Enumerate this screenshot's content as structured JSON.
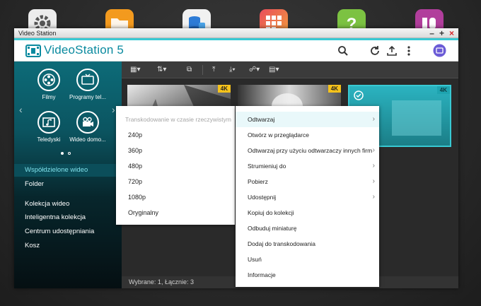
{
  "desktop": {
    "icons": [
      "settings-icon",
      "file-station-icon",
      "storage-icon",
      "app-center-icon",
      "help-icon",
      "hd-station-icon"
    ]
  },
  "window": {
    "title": "Video Station",
    "controls": {
      "minimize": "–",
      "maximize": "+",
      "close": "×"
    }
  },
  "app": {
    "title": "VideoStation 5",
    "accent_color": "#38c9d3",
    "brand_color": "#0a8a9f"
  },
  "sidebar": {
    "categories": [
      {
        "label": "Filmy",
        "icon": "film-reel-icon"
      },
      {
        "label": "Programy tel...",
        "icon": "tv-icon"
      },
      {
        "label": "Teledyski",
        "icon": "music-video-icon"
      },
      {
        "label": "Wideo domo...",
        "icon": "home-video-camera-icon"
      }
    ],
    "nav_items": [
      {
        "label": "Współdzielone wideo",
        "active": true
      },
      {
        "label": "Folder",
        "active": false
      },
      {
        "label": "Kolekcja wideo",
        "active": false
      },
      {
        "label": "Inteligentna kolekcja",
        "active": false
      },
      {
        "label": "Centrum udostępniania",
        "active": false
      },
      {
        "label": "Kosz",
        "active": false
      }
    ]
  },
  "main": {
    "thumbnails": [
      {
        "badge": "4K",
        "selected": false
      },
      {
        "badge": "4K",
        "selected": false
      },
      {
        "badge": "4K",
        "selected": true
      }
    ],
    "status": "Wybrane: 1, Łącznie: 3"
  },
  "transcode_menu": {
    "header": "Transkodowanie w czasie rzeczywistym",
    "options": [
      "240p",
      "360p",
      "480p",
      "720p",
      "1080p",
      "Oryginalny"
    ]
  },
  "context_menu": {
    "items": [
      {
        "label": "Odtwarzaj",
        "submenu": true,
        "highlighted": true
      },
      {
        "label": "Otwórz w przeglądarce",
        "submenu": false,
        "highlighted": false
      },
      {
        "label": "Odtwarzaj przy użyciu odtwarzaczy innych firm",
        "submenu": true,
        "highlighted": false
      },
      {
        "label": "Strumieniuj do",
        "submenu": true,
        "highlighted": false
      },
      {
        "label": "Pobierz",
        "submenu": true,
        "highlighted": false
      },
      {
        "label": "Udostępnij",
        "submenu": true,
        "highlighted": false
      },
      {
        "label": "Kopiuj do kolekcji",
        "submenu": false,
        "highlighted": false
      },
      {
        "label": "Odbuduj miniaturę",
        "submenu": false,
        "highlighted": false
      },
      {
        "label": "Dodaj do transkodowania",
        "submenu": false,
        "highlighted": false
      },
      {
        "label": "Usuń",
        "submenu": false,
        "highlighted": false
      },
      {
        "label": "Informacje",
        "submenu": false,
        "highlighted": false
      }
    ]
  }
}
